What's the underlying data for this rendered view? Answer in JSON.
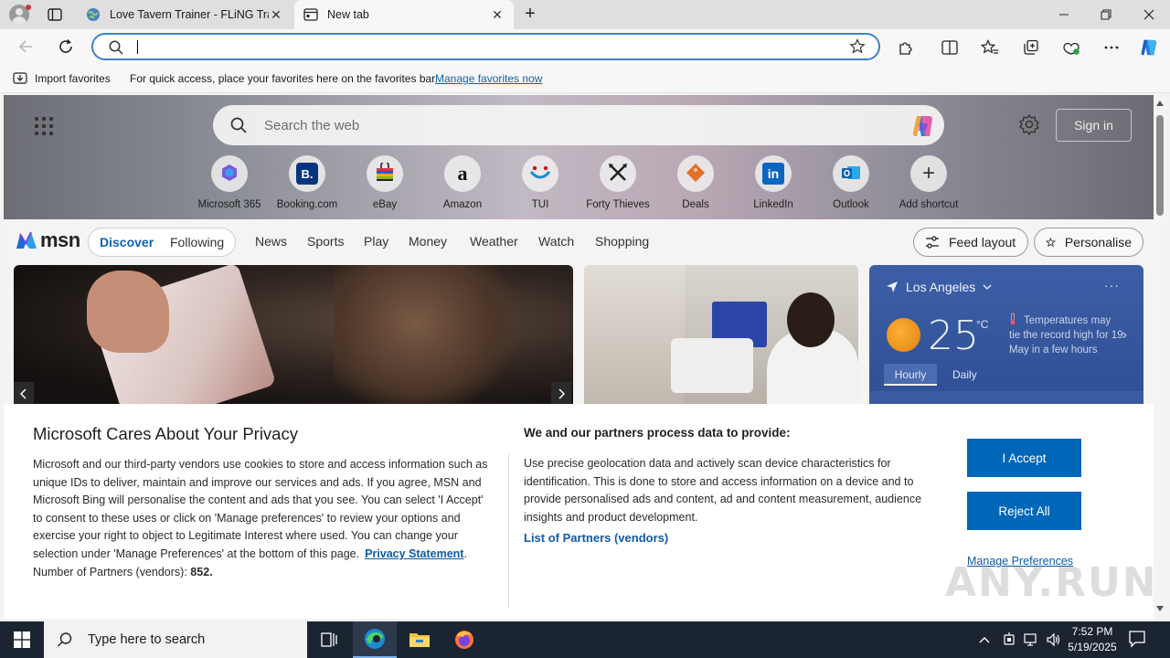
{
  "browser": {
    "tabs": [
      {
        "title": "Love Tavern Trainer - FLiNG Trainer",
        "active": false
      },
      {
        "title": "New tab",
        "active": true
      }
    ],
    "address": {
      "value": ""
    },
    "favorites_bar": {
      "import_label": "Import favorites",
      "message": "For quick access, place your favorites here on the favorites bar.",
      "manage_link": "Manage favorites now"
    }
  },
  "newtab": {
    "search_placeholder": "Search the web",
    "sign_in": "Sign in",
    "shortcuts": [
      {
        "label": "Microsoft 365",
        "icon": "microsoft365-icon"
      },
      {
        "label": "Booking.com",
        "icon": "booking-icon"
      },
      {
        "label": "eBay",
        "icon": "ebay-icon"
      },
      {
        "label": "Amazon",
        "icon": "amazon-icon"
      },
      {
        "label": "TUI",
        "icon": "tui-icon"
      },
      {
        "label": "Forty Thieves",
        "icon": "forty-thieves-icon"
      },
      {
        "label": "Deals",
        "icon": "deals-icon"
      },
      {
        "label": "LinkedIn",
        "icon": "linkedin-icon"
      },
      {
        "label": "Outlook",
        "icon": "outlook-icon"
      },
      {
        "label": "Add shortcut",
        "icon": "plus-icon"
      }
    ],
    "msn": {
      "logo": "msn",
      "feed_tabs": [
        "Discover",
        "Following"
      ],
      "nav": [
        "News",
        "Sports",
        "Play",
        "Money",
        "Weather",
        "Watch",
        "Shopping"
      ],
      "feed_layout": "Feed layout",
      "personalise": "Personalise"
    },
    "weather": {
      "location": "Los Angeles",
      "temperature": "25",
      "unit": "°C",
      "alert": "Temperatures may tie the record high for 19 May in a few hours",
      "tabs": [
        "Hourly",
        "Daily"
      ]
    }
  },
  "privacy": {
    "title": "Microsoft Cares About Your Privacy",
    "body": "Microsoft and our third-party vendors use cookies to store and access information such as unique IDs to deliver, maintain and improve our services and ads. If you agree, MSN and Microsoft Bing will personalise the content and ads that you see. You can select 'I Accept' to consent to these uses or click on 'Manage preferences' to review your options and exercise your right to object to Legitimate Interest where used.  You can change your selection under 'Manage Preferences' at the bottom of this page.",
    "privacy_link": "Privacy Statement",
    "partners_label": "Number of Partners (vendors):",
    "partners_count": "852.",
    "right_title": "We and our partners process data to provide:",
    "right_body": "Use precise geolocation data and actively scan device characteristics for identification. This is done to store and access information on a device and to provide personalised ads and content, ad and content measurement, audience insights and product development.",
    "partners_link": "List of Partners (vendors)",
    "accept": "I Accept",
    "reject": "Reject All",
    "manage": "Manage Preferences"
  },
  "taskbar": {
    "search_placeholder": "Type here to search",
    "time": "7:52 PM",
    "date": "5/19/2025"
  },
  "watermark": "ANY.RUN",
  "colors": {
    "accent": "#0067b8",
    "link": "#0f5aa6",
    "omnibox_border": "#3b82c9",
    "taskbar": "#1b2431"
  }
}
